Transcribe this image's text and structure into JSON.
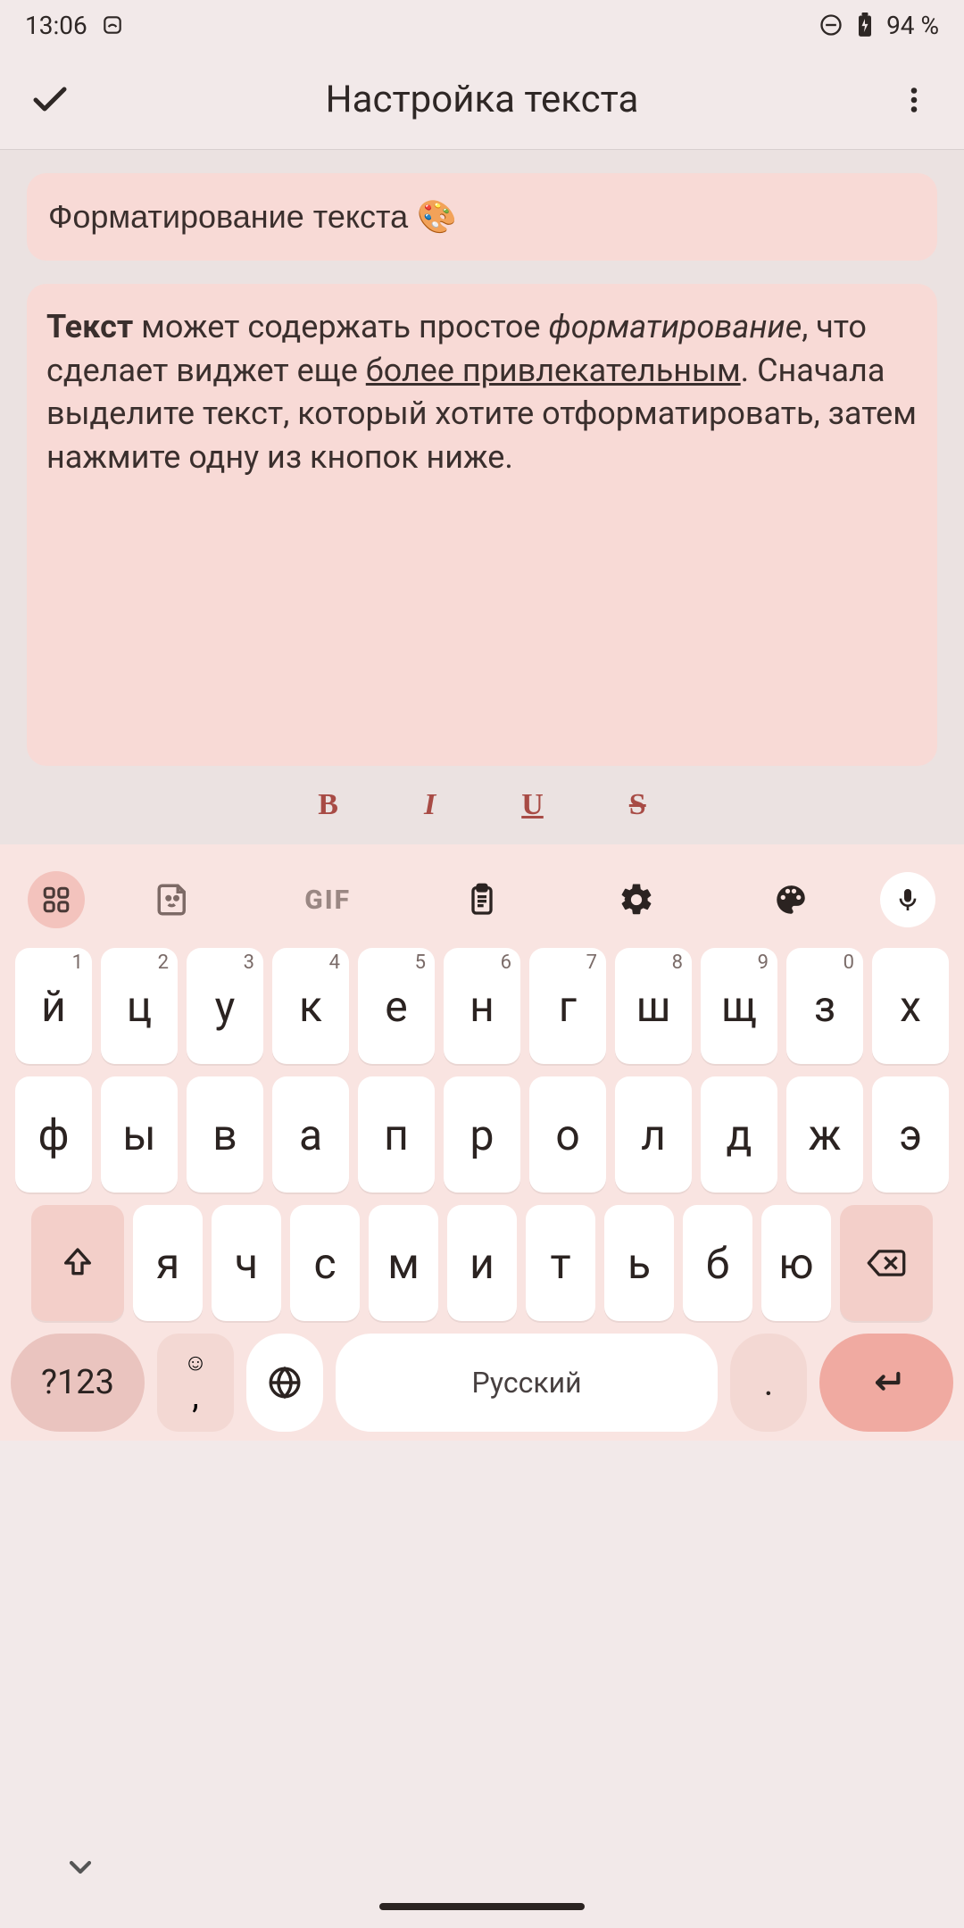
{
  "status": {
    "time": "13:06",
    "battery": "94 %"
  },
  "appbar": {
    "title": "Настройка текста"
  },
  "content": {
    "title_value": "Форматирование текста 🎨",
    "body_bold": "Текст",
    "body_p1": " может содержать простое ",
    "body_italic": "форматирование",
    "body_p2": ", что сделает виджет еще ",
    "body_underline": "более привлекательным",
    "body_p3": ". Сначала выделите текст, который хотите отформатировать, затем нажмите одну из кнопок ниже."
  },
  "fmt": {
    "bold": "B",
    "italic": "I",
    "underline": "U",
    "strike": "S"
  },
  "keyboard": {
    "gif_label": "GIF",
    "row1": [
      {
        "main": "й",
        "hint": "1"
      },
      {
        "main": "ц",
        "hint": "2"
      },
      {
        "main": "у",
        "hint": "3"
      },
      {
        "main": "к",
        "hint": "4"
      },
      {
        "main": "е",
        "hint": "5"
      },
      {
        "main": "н",
        "hint": "6"
      },
      {
        "main": "г",
        "hint": "7"
      },
      {
        "main": "ш",
        "hint": "8"
      },
      {
        "main": "щ",
        "hint": "9"
      },
      {
        "main": "з",
        "hint": "0"
      },
      {
        "main": "х",
        "hint": ""
      }
    ],
    "row2": [
      {
        "main": "ф"
      },
      {
        "main": "ы"
      },
      {
        "main": "в"
      },
      {
        "main": "а"
      },
      {
        "main": "п"
      },
      {
        "main": "р"
      },
      {
        "main": "о"
      },
      {
        "main": "л"
      },
      {
        "main": "д"
      },
      {
        "main": "ж"
      },
      {
        "main": "э"
      }
    ],
    "row3": [
      {
        "main": "я"
      },
      {
        "main": "ч"
      },
      {
        "main": "с"
      },
      {
        "main": "м"
      },
      {
        "main": "и"
      },
      {
        "main": "т"
      },
      {
        "main": "ь"
      },
      {
        "main": "б"
      },
      {
        "main": "ю"
      }
    ],
    "sym_label": "?123",
    "emoji_top": "☺",
    "emoji_bot": ",",
    "space_label": "Русский",
    "dot_label": "."
  }
}
